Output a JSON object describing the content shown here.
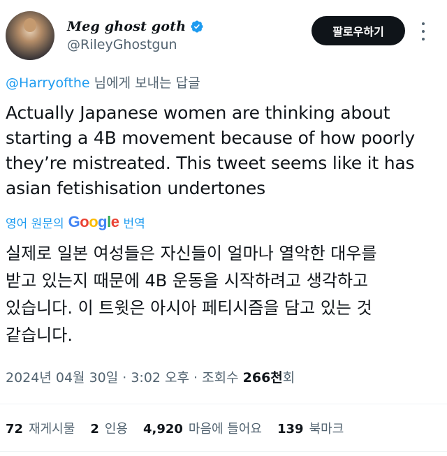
{
  "user": {
    "display_name": "Meg ghost goth",
    "handle": "@RileyGhostgun",
    "avatar_icon": "profile-avatar",
    "verified_icon": "verified-badge-icon"
  },
  "follow_button": "팔로우하기",
  "more_icon": "more-vertical-icon",
  "reply_context": {
    "mention": "@Harryofthe",
    "suffix": " 님에게 보내는 답글"
  },
  "tweet_lines": [
    "Actually Japanese women are thinking about",
    "starting a 4B movement because of how poorly",
    "they’re mistreated. This tweet seems like it has",
    "asian fetishisation undertones"
  ],
  "translate": {
    "prefix": "영어 원문의",
    "google_letters": [
      "G",
      "o",
      "o",
      "g",
      "l",
      "e"
    ],
    "label": "번역"
  },
  "translated_lines": [
    "실제로 일본 여성들은 자신들이 얼마나 열악한 대우를",
    "받고 있는지 때문에 4B 운동을 시작하려고 생각하고",
    "있습니다. 이 트윗은 아시아 페티시즘을 담고 있는 것",
    "같습니다."
  ],
  "meta": {
    "date_time": "2024년 04월 30일 · 3:02 오후 · 조회수 ",
    "views": "266천",
    "views_suffix": "회"
  },
  "stats": {
    "reposts": {
      "count": "72",
      "label": "재게시물"
    },
    "quotes": {
      "count": "2",
      "label": "인용"
    },
    "likes": {
      "count": "4,920",
      "label": "마음에 들어요"
    },
    "bookmarks": {
      "count": "139",
      "label": "북마크"
    }
  },
  "colors": {
    "link": "#1d9bf0",
    "secondary": "#536471",
    "primary_text": "#0f1419",
    "button_bg": "#0f1419"
  }
}
